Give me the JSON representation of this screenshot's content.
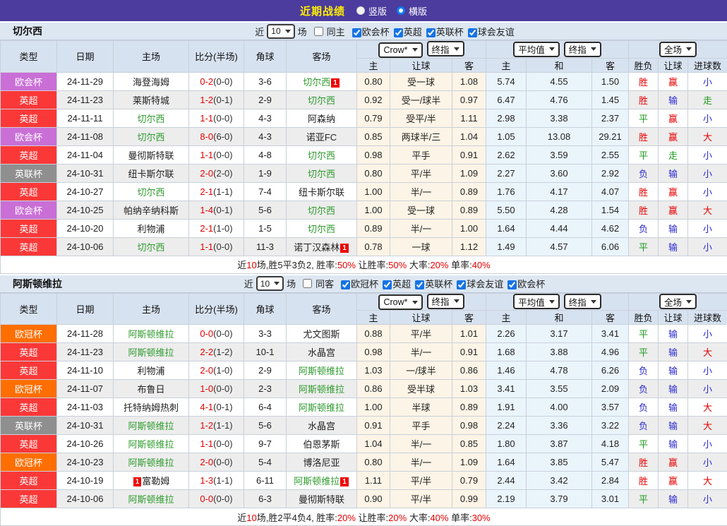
{
  "topbar": {
    "title": "近期战绩",
    "view_options": [
      {
        "label": "竖版",
        "selected": false
      },
      {
        "label": "横版",
        "selected": true
      }
    ]
  },
  "columns": {
    "left": [
      "类型",
      "日期",
      "主场",
      "比分(半场)",
      "角球",
      "客场"
    ],
    "sub": [
      "主",
      "让球",
      "客",
      "主",
      "和",
      "客",
      "胜负",
      "让球",
      "进球数"
    ]
  },
  "dropdowns": {
    "bookmaker": "Crow*",
    "final_odds": "终指",
    "average": "平均值",
    "scope": "全场"
  },
  "league_colors": {
    "欧会杯": "#c96fd6",
    "英超": "#fb3838",
    "英联杯": "#8f8f8f",
    "欧冠杯": "#ff6e00"
  },
  "outcome_colors": {
    "胜": "#e60000",
    "平": "#1e9b1e",
    "负": "#2a2ad0",
    "赢": "#e60000",
    "输": "#2a2ad0",
    "走": "#1e9b1e",
    "大": "#e60000",
    "小": "#2a2ad0"
  },
  "sections": [
    {
      "team": "切尔西",
      "filter": {
        "recent_label": "近",
        "games_count": "10",
        "games_label": "场",
        "same_checked": false,
        "same_label": "同主",
        "leagues": [
          "欧会杯",
          "英超",
          "英联杯",
          "球会友谊"
        ]
      },
      "rows": [
        {
          "type": "欧会杯",
          "date": "24-11-29",
          "home": "海登海姆",
          "home_green": false,
          "home_badge": "",
          "score": "0-2",
          "half": "(0-0)",
          "corners": "3-6",
          "away": "切尔西",
          "away_green": true,
          "away_badge": "1",
          "odds": [
            "0.80",
            "受一球",
            "1.08"
          ],
          "avg": [
            "5.74",
            "4.55",
            "1.50"
          ],
          "results": [
            "胜",
            "赢",
            "小"
          ]
        },
        {
          "type": "英超",
          "date": "24-11-23",
          "home": "莱斯特城",
          "home_green": false,
          "home_badge": "",
          "score": "1-2",
          "half": "(0-1)",
          "corners": "2-9",
          "away": "切尔西",
          "away_green": true,
          "away_badge": "",
          "odds": [
            "0.92",
            "受一/球半",
            "0.97"
          ],
          "avg": [
            "6.47",
            "4.76",
            "1.45"
          ],
          "results": [
            "胜",
            "输",
            "走"
          ]
        },
        {
          "type": "英超",
          "date": "24-11-11",
          "home": "切尔西",
          "home_green": true,
          "home_badge": "",
          "score": "1-1",
          "half": "(0-0)",
          "corners": "4-3",
          "away": "阿森纳",
          "away_green": false,
          "away_badge": "",
          "odds": [
            "0.79",
            "受平/半",
            "1.11"
          ],
          "avg": [
            "2.98",
            "3.38",
            "2.37"
          ],
          "results": [
            "平",
            "赢",
            "小"
          ]
        },
        {
          "type": "欧会杯",
          "date": "24-11-08",
          "home": "切尔西",
          "home_green": true,
          "home_badge": "",
          "score": "8-0",
          "half": "(6-0)",
          "corners": "4-3",
          "away": "诺亚FC",
          "away_green": false,
          "away_badge": "",
          "odds": [
            "0.85",
            "两球半/三",
            "1.04"
          ],
          "avg": [
            "1.05",
            "13.08",
            "29.21"
          ],
          "results": [
            "胜",
            "赢",
            "大"
          ]
        },
        {
          "type": "英超",
          "date": "24-11-04",
          "home": "曼彻斯特联",
          "home_green": false,
          "home_badge": "",
          "score": "1-1",
          "half": "(0-0)",
          "corners": "4-8",
          "away": "切尔西",
          "away_green": true,
          "away_badge": "",
          "odds": [
            "0.98",
            "平手",
            "0.91"
          ],
          "avg": [
            "2.62",
            "3.59",
            "2.55"
          ],
          "results": [
            "平",
            "走",
            "小"
          ]
        },
        {
          "type": "英联杯",
          "date": "24-10-31",
          "home": "纽卡斯尔联",
          "home_green": false,
          "home_badge": "",
          "score": "2-0",
          "half": "(2-0)",
          "corners": "1-9",
          "away": "切尔西",
          "away_green": true,
          "away_badge": "",
          "odds": [
            "0.80",
            "平/半",
            "1.09"
          ],
          "avg": [
            "2.27",
            "3.60",
            "2.92"
          ],
          "results": [
            "负",
            "输",
            "小"
          ]
        },
        {
          "type": "英超",
          "date": "24-10-27",
          "home": "切尔西",
          "home_green": true,
          "home_badge": "",
          "score": "2-1",
          "half": "(1-1)",
          "corners": "7-4",
          "away": "纽卡斯尔联",
          "away_green": false,
          "away_badge": "",
          "odds": [
            "1.00",
            "半/一",
            "0.89"
          ],
          "avg": [
            "1.76",
            "4.17",
            "4.07"
          ],
          "results": [
            "胜",
            "赢",
            "小"
          ]
        },
        {
          "type": "欧会杯",
          "date": "24-10-25",
          "home": "帕纳辛纳科斯",
          "home_green": false,
          "home_badge": "",
          "score": "1-4",
          "half": "(0-1)",
          "corners": "5-6",
          "away": "切尔西",
          "away_green": true,
          "away_badge": "",
          "odds": [
            "1.00",
            "受一球",
            "0.89"
          ],
          "avg": [
            "5.50",
            "4.28",
            "1.54"
          ],
          "results": [
            "胜",
            "赢",
            "大"
          ]
        },
        {
          "type": "英超",
          "date": "24-10-20",
          "home": "利物浦",
          "home_green": false,
          "home_badge": "",
          "score": "2-1",
          "half": "(1-0)",
          "corners": "1-5",
          "away": "切尔西",
          "away_green": true,
          "away_badge": "",
          "odds": [
            "0.89",
            "半/一",
            "1.00"
          ],
          "avg": [
            "1.64",
            "4.44",
            "4.62"
          ],
          "results": [
            "负",
            "输",
            "小"
          ]
        },
        {
          "type": "英超",
          "date": "24-10-06",
          "home": "切尔西",
          "home_green": true,
          "home_badge": "",
          "score": "1-1",
          "half": "(0-0)",
          "corners": "11-3",
          "away": "诺丁汉森林",
          "away_green": false,
          "away_badge": "1",
          "odds": [
            "0.78",
            "一球",
            "1.12"
          ],
          "avg": [
            "1.49",
            "4.57",
            "6.06"
          ],
          "results": [
            "平",
            "输",
            "小"
          ]
        }
      ],
      "summary": [
        {
          "t": "近",
          "red": false
        },
        {
          "t": "10",
          "red": true
        },
        {
          "t": "场,胜5平3负2, 胜率:",
          "red": false
        },
        {
          "t": "50%",
          "red": true
        },
        {
          "t": " 让胜率:",
          "red": false
        },
        {
          "t": "50%",
          "red": true
        },
        {
          "t": " 大率:",
          "red": false
        },
        {
          "t": "20%",
          "red": true
        },
        {
          "t": " 单率:",
          "red": false
        },
        {
          "t": "40%",
          "red": true
        }
      ]
    },
    {
      "team": "阿斯顿维拉",
      "filter": {
        "recent_label": "近",
        "games_count": "10",
        "games_label": "场",
        "same_checked": false,
        "same_label": "同客",
        "leagues": [
          "欧冠杯",
          "英超",
          "英联杯",
          "球会友谊",
          "欧会杯"
        ]
      },
      "rows": [
        {
          "type": "欧冠杯",
          "date": "24-11-28",
          "home": "阿斯顿维拉",
          "home_green": true,
          "home_badge": "",
          "score": "0-0",
          "half": "(0-0)",
          "corners": "3-3",
          "away": "尤文图斯",
          "away_green": false,
          "away_badge": "",
          "odds": [
            "0.88",
            "平/半",
            "1.01"
          ],
          "avg": [
            "2.26",
            "3.17",
            "3.41"
          ],
          "results": [
            "平",
            "输",
            "小"
          ]
        },
        {
          "type": "英超",
          "date": "24-11-23",
          "home": "阿斯顿维拉",
          "home_green": true,
          "home_badge": "",
          "score": "2-2",
          "half": "(1-2)",
          "corners": "10-1",
          "away": "水晶宫",
          "away_green": false,
          "away_badge": "",
          "odds": [
            "0.98",
            "半/一",
            "0.91"
          ],
          "avg": [
            "1.68",
            "3.88",
            "4.96"
          ],
          "results": [
            "平",
            "输",
            "大"
          ]
        },
        {
          "type": "英超",
          "date": "24-11-10",
          "home": "利物浦",
          "home_green": false,
          "home_badge": "",
          "score": "2-0",
          "half": "(1-0)",
          "corners": "2-9",
          "away": "阿斯顿维拉",
          "away_green": true,
          "away_badge": "",
          "odds": [
            "1.03",
            "一/球半",
            "0.86"
          ],
          "avg": [
            "1.46",
            "4.78",
            "6.26"
          ],
          "results": [
            "负",
            "输",
            "小"
          ]
        },
        {
          "type": "欧冠杯",
          "date": "24-11-07",
          "home": "布鲁日",
          "home_green": false,
          "home_badge": "",
          "score": "1-0",
          "half": "(0-0)",
          "corners": "2-3",
          "away": "阿斯顿维拉",
          "away_green": true,
          "away_badge": "",
          "odds": [
            "0.86",
            "受半球",
            "1.03"
          ],
          "avg": [
            "3.41",
            "3.55",
            "2.09"
          ],
          "results": [
            "负",
            "输",
            "小"
          ]
        },
        {
          "type": "英超",
          "date": "24-11-03",
          "home": "托特纳姆热刺",
          "home_green": false,
          "home_badge": "",
          "score": "4-1",
          "half": "(0-1)",
          "corners": "6-4",
          "away": "阿斯顿维拉",
          "away_green": true,
          "away_badge": "",
          "odds": [
            "1.00",
            "半球",
            "0.89"
          ],
          "avg": [
            "1.91",
            "4.00",
            "3.57"
          ],
          "results": [
            "负",
            "输",
            "大"
          ]
        },
        {
          "type": "英联杯",
          "date": "24-10-31",
          "home": "阿斯顿维拉",
          "home_green": true,
          "home_badge": "",
          "score": "1-2",
          "half": "(1-1)",
          "corners": "5-6",
          "away": "水晶宫",
          "away_green": false,
          "away_badge": "",
          "odds": [
            "0.91",
            "平手",
            "0.98"
          ],
          "avg": [
            "2.24",
            "3.36",
            "3.22"
          ],
          "results": [
            "负",
            "输",
            "大"
          ]
        },
        {
          "type": "英超",
          "date": "24-10-26",
          "home": "阿斯顿维拉",
          "home_green": true,
          "home_badge": "",
          "score": "1-1",
          "half": "(0-0)",
          "corners": "9-7",
          "away": "伯恩茅斯",
          "away_green": false,
          "away_badge": "",
          "odds": [
            "1.04",
            "半/一",
            "0.85"
          ],
          "avg": [
            "1.80",
            "3.87",
            "4.18"
          ],
          "results": [
            "平",
            "输",
            "小"
          ]
        },
        {
          "type": "欧冠杯",
          "date": "24-10-23",
          "home": "阿斯顿维拉",
          "home_green": true,
          "home_badge": "",
          "score": "2-0",
          "half": "(0-0)",
          "corners": "5-4",
          "away": "博洛尼亚",
          "away_green": false,
          "away_badge": "",
          "odds": [
            "0.80",
            "半/一",
            "1.09"
          ],
          "avg": [
            "1.64",
            "3.85",
            "5.47"
          ],
          "results": [
            "胜",
            "赢",
            "小"
          ]
        },
        {
          "type": "英超",
          "date": "24-10-19",
          "home": "富勒姆",
          "home_green": false,
          "home_badge": "1",
          "score": "1-3",
          "half": "(1-1)",
          "corners": "6-11",
          "away": "阿斯顿维拉",
          "away_green": true,
          "away_badge": "1",
          "odds": [
            "1.11",
            "平/半",
            "0.79"
          ],
          "avg": [
            "2.44",
            "3.42",
            "2.84"
          ],
          "results": [
            "胜",
            "赢",
            "大"
          ]
        },
        {
          "type": "英超",
          "date": "24-10-06",
          "home": "阿斯顿维拉",
          "home_green": true,
          "home_badge": "",
          "score": "0-0",
          "half": "(0-0)",
          "corners": "6-3",
          "away": "曼彻斯特联",
          "away_green": false,
          "away_badge": "",
          "odds": [
            "0.90",
            "平/半",
            "0.99"
          ],
          "avg": [
            "2.19",
            "3.79",
            "3.01"
          ],
          "results": [
            "平",
            "输",
            "小"
          ]
        }
      ],
      "summary": [
        {
          "t": "近",
          "red": false
        },
        {
          "t": "10",
          "red": true
        },
        {
          "t": "场,胜2平4负4, 胜率:",
          "red": false
        },
        {
          "t": "20%",
          "red": true
        },
        {
          "t": " 让胜率:",
          "red": false
        },
        {
          "t": "20%",
          "red": true
        },
        {
          "t": " 大率:",
          "red": false
        },
        {
          "t": "40%",
          "red": true
        },
        {
          "t": " 单率:",
          "red": false
        },
        {
          "t": "30%",
          "red": true
        }
      ]
    }
  ]
}
